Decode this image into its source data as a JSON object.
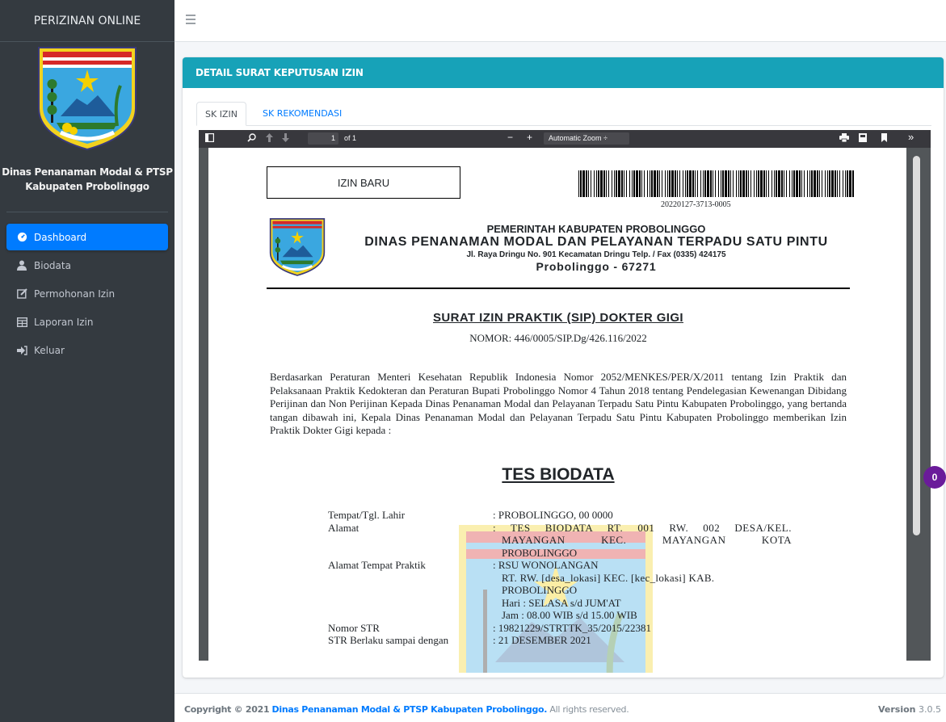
{
  "brand": {
    "title": "PERIZINAN ONLINE"
  },
  "sidebar": {
    "org_name_line1": "Dinas Penanaman Modal & PTSP",
    "org_name_line2": "Kabupaten Probolinggo",
    "items": [
      {
        "label": "Dashboard",
        "icon": "dashboard-icon",
        "active": true
      },
      {
        "label": "Biodata",
        "icon": "user-icon"
      },
      {
        "label": "Permohonan Izin",
        "icon": "edit-icon"
      },
      {
        "label": "Laporan Izin",
        "icon": "table-icon"
      },
      {
        "label": "Keluar",
        "icon": "sign-out-icon"
      }
    ]
  },
  "card": {
    "title": "DETAIL SURAT KEPUTUSAN IZIN",
    "tabs": [
      {
        "label": "SK IZIN",
        "active": true
      },
      {
        "label": "SK REKOMENDASI"
      }
    ]
  },
  "pdf_viewer": {
    "page_number": "1",
    "page_total": "of 1",
    "zoom": "Automatic Zoom"
  },
  "document": {
    "status_box": "IZIN BARU",
    "barcode_number": "20220127-3713-0005",
    "kop_line1": "PEMERINTAH KABUPATEN PROBOLINGGO",
    "kop_line2": "DINAS PENANAMAN MODAL DAN PELAYANAN TERPADU SATU PINTU",
    "kop_line3": "Jl. Raya Dringu No. 901 Kecamatan Dringu Telp. / Fax (0335) 424175",
    "kop_line4": "Probolinggo - 67271",
    "title": "SURAT IZIN PRAKTIK (SIP) DOKTER GIGI",
    "number": "NOMOR: 446/0005/SIP.Dg/426.116/2022",
    "paragraph": "Berdasarkan Peraturan Menteri Kesehatan Republik Indonesia Nomor 2052/MENKES/PER/X/2011 tentang Izin Praktik dan Pelaksanaan Praktik Kedokteran dan Peraturan Bupati Probolinggo Nomor 4 Tahun 2018 tentang Pendelegasian Kewenangan Dibidang Perijinan dan Non Perijinan Kepada Dinas Penanaman Modal dan Pelayanan Terpadu Satu Pintu Kabupaten Probolinggo, yang bertanda tangan dibawah ini, Kepala Dinas Penanaman Modal dan Pelayanan Terpadu Satu Pintu Kabupaten Probolinggo memberikan Izin Praktik Dokter Gigi kepada :",
    "applicant_name": "TES BIODATA",
    "fields": {
      "tempat_label": "Tempat/Tgl. Lahir",
      "tempat_value": ": PROBOLINGGO, 00 0000",
      "alamat_label": "Alamat",
      "alamat_value_1": ": TES BIODATA RT. 001 RW. 002 DESA/KEL.",
      "alamat_value_2": "MAYANGAN KEC. MAYANGAN KOTA",
      "alamat_value_3": "PROBOLINGGO",
      "praktik_label": "Alamat Tempat Praktik",
      "praktik_value_1": ": RSU WONOLANGAN",
      "praktik_value_2": "RT. RW. [desa_lokasi] KEC. [kec_lokasi] KAB.",
      "praktik_value_3": "PROBOLINGGO",
      "praktik_value_4": "Hari : SELASA s/d JUM'AT",
      "praktik_value_5": "Jam : 08.00 WIB s/d 15.00 WIB",
      "str_label": "Nomor STR",
      "str_value": ": 19821229/STRTTK_35/2015/22381",
      "berlaku_label": "STR Berlaku sampai dengan",
      "berlaku_value": ": 21 DESEMBER 2021"
    }
  },
  "notification_badge": "0",
  "footer": {
    "copyright": "Copyright © 2021",
    "org_link": "Dinas Penanaman Modal & PTSP Kabupaten Probolinggo.",
    "rights": "All rights reserved.",
    "version_label": "Version",
    "version_number": "3.0.5"
  },
  "colors": {
    "sidebar": "#343a40",
    "active_nav": "#007bff",
    "card_header": "#17a2b8",
    "badge": "#6a1b9a"
  }
}
